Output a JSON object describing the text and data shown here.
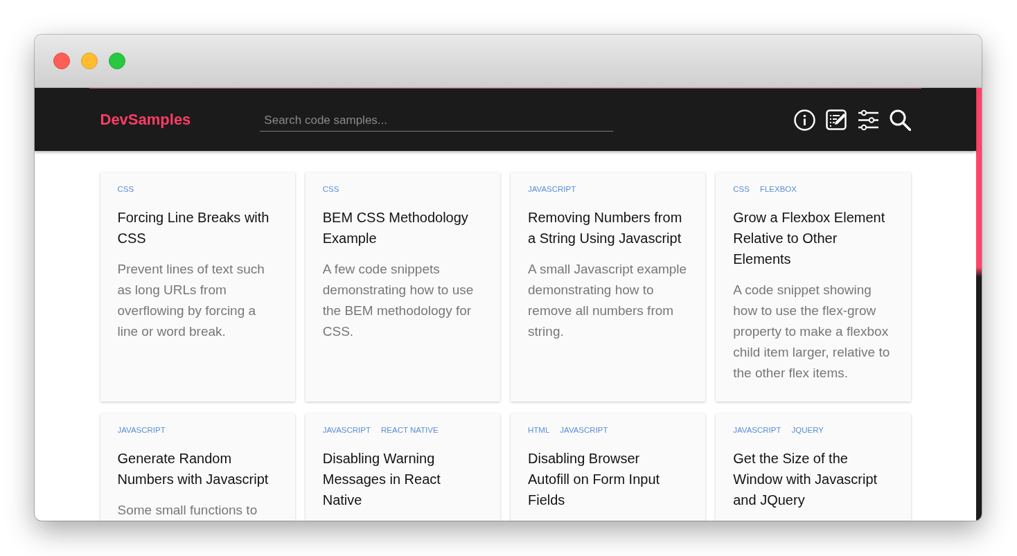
{
  "header": {
    "brand": "DevSamples",
    "search": {
      "placeholder": "Search code samples..."
    },
    "actions": [
      {
        "kind": "info"
      },
      {
        "kind": "notes"
      },
      {
        "kind": "filters"
      },
      {
        "kind": "search"
      }
    ]
  },
  "cards": [
    {
      "tags": [
        "CSS"
      ],
      "title": "Forcing Line Breaks with CSS",
      "description": "Prevent lines of text such as long URLs from overflowing by forcing a line or word break."
    },
    {
      "tags": [
        "CSS"
      ],
      "title": "BEM CSS Methodology Example",
      "description": "A few code snippets demonstrating how to use the BEM methodology for CSS."
    },
    {
      "tags": [
        "JAVASCRIPT"
      ],
      "title": "Removing Numbers from a String Using Javascript",
      "description": "A small Javascript example demonstrating how to remove all numbers from string."
    },
    {
      "tags": [
        "CSS",
        "FLEXBOX"
      ],
      "title": "Grow a Flexbox Element Relative to Other Elements",
      "description": "A code snippet showing how to use the flex-grow property to make a flexbox child item larger, relative to the other flex items."
    },
    {
      "tags": [
        "JAVASCRIPT"
      ],
      "title": "Generate Random Numbers with Javascript",
      "description": "Some small functions to"
    },
    {
      "tags": [
        "JAVASCRIPT",
        "REACT NATIVE"
      ],
      "title": "Disabling Warning Messages in React Native"
    },
    {
      "tags": [
        "HTML",
        "JAVASCRIPT"
      ],
      "title": "Disabling Browser Autofill on Form Input Fields"
    },
    {
      "tags": [
        "JAVASCRIPT",
        "JQUERY"
      ],
      "title": "Get the Size of the Window with Javascript and JQuery"
    }
  ]
}
